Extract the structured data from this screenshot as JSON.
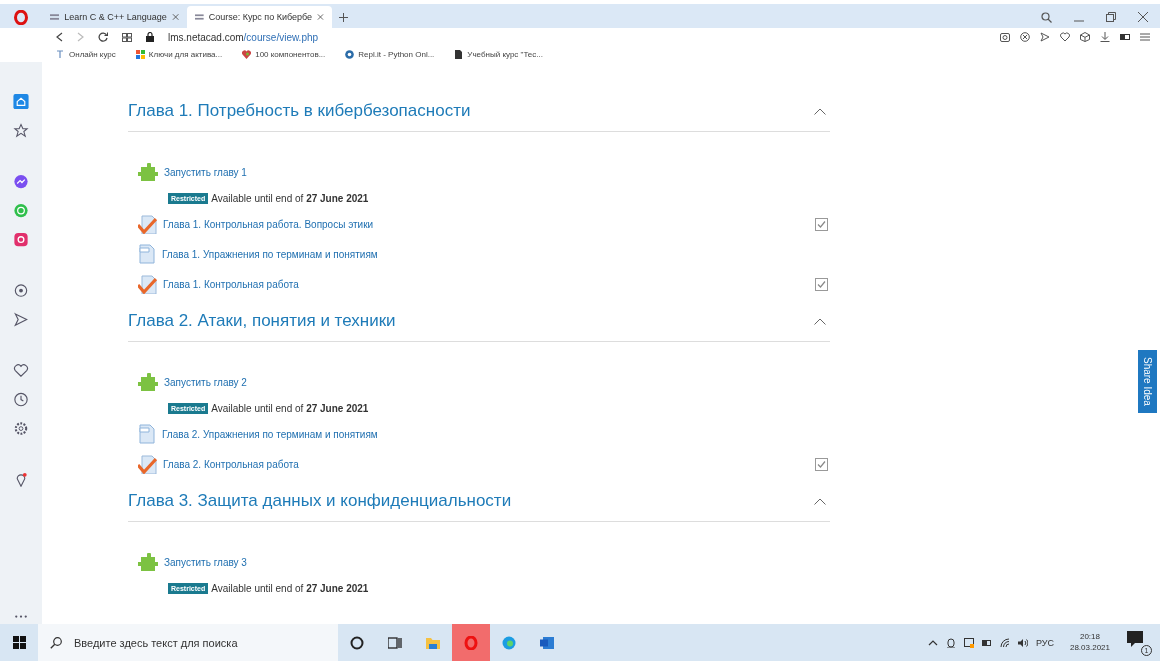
{
  "browser": {
    "tabs": [
      {
        "title": "Learn C & C++ Language",
        "selected": false
      },
      {
        "title": "Course: Курс по Кибербе",
        "selected": true
      }
    ],
    "address": {
      "host": "lms.netacad.com",
      "path": "/course/view.php"
    },
    "bookmarks": [
      {
        "label": "Онлайн курс",
        "kind": "pin"
      },
      {
        "label": "Ключи для актива...",
        "kind": "tiles"
      },
      {
        "label": "100 компонентов...",
        "kind": "heart"
      },
      {
        "label": "Repl.it - Python Onl...",
        "kind": "circle"
      },
      {
        "label": "Учебный курс \"Тес...",
        "kind": "doc"
      }
    ]
  },
  "sections": [
    {
      "title": "Глава 1. Потребность в кибербезопасности",
      "expanded": true,
      "items": [
        {
          "kind": "launch",
          "label": "Запустить главу 1"
        },
        {
          "kind": "restriction",
          "badge": "Restricted",
          "text": "Available until end of **27 June 2021**"
        },
        {
          "kind": "quiz",
          "label": "Глава 1. Контрольная работа. Вопросы этики",
          "checked": true
        },
        {
          "kind": "page",
          "label": "Глава 1. Упражнения по терминам и понятиям"
        },
        {
          "kind": "quiz",
          "label": "Глава 1. Контрольная работа",
          "checked": true
        }
      ]
    },
    {
      "title": "Глава 2. Атаки, понятия и техники",
      "expanded": true,
      "items": [
        {
          "kind": "launch",
          "label": "Запустить главу 2"
        },
        {
          "kind": "restriction",
          "badge": "Restricted",
          "text": "Available until end of **27 June 2021**"
        },
        {
          "kind": "page",
          "label": "Глава 2. Упражнения по терминам и понятиям"
        },
        {
          "kind": "quiz",
          "label": "Глава 2. Контрольная работа",
          "checked": true
        }
      ]
    },
    {
      "title": "Глава 3. Защита данных и конфиденциальности",
      "expanded": true,
      "items": [
        {
          "kind": "launch",
          "label": "Запустить главу 3"
        },
        {
          "kind": "restriction",
          "badge": "Restricted",
          "text": "Available until end of **27 June 2021**"
        }
      ]
    }
  ],
  "share_button": "Share Idea",
  "taskbar": {
    "search": {
      "placeholder": "Введите здесь текст для поиска"
    },
    "language": "РУС",
    "time": "20:18",
    "date": "28.03.2021",
    "notifications": "1"
  }
}
